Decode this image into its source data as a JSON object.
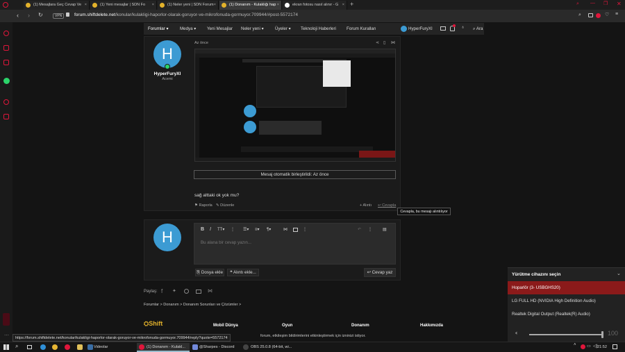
{
  "tabs": [
    {
      "label": "(1) Mesajlara Geç Cevap Ve"
    },
    {
      "label": "(1) Yeni mesajlar | SDN Fo"
    },
    {
      "label": "(1) Neler yeni | SDN Forum"
    },
    {
      "label": "(1) Donanım - Kulaklığı hap"
    },
    {
      "label": "ekran fotosu nasıl alınır - G"
    }
  ],
  "address": {
    "badge": "VPN",
    "domain": "forum.shiftdelete.net",
    "path": "/konular/kulakligi-haporlor-olarak-goruyor-ve-mikrofonuda-gormuyor.709944/#post-5572174"
  },
  "nav": {
    "items": [
      "Forumlar",
      "Medya",
      "Yeni Mesajlar",
      "Neler yeni",
      "Üyeler",
      "Teknoloji Haberleri",
      "Forum Kuralları"
    ],
    "user": "HyperFuryXI",
    "search": "Ara"
  },
  "post": {
    "avatar_letter": "H",
    "username": "HyperFuryXI",
    "role": "Acemi",
    "time": "Az önce",
    "merged_label": "Mesaj otomatik birleştirildi: Az önce",
    "message": "sağ alttaki ok yok mu?",
    "report": "Raporla",
    "edit": "Düzenle",
    "quote": "Alıntı",
    "reply": "Cevapla"
  },
  "tooltip": "Cevapla, bu mesajı alıntılıyor",
  "editor": {
    "avatar_letter": "H",
    "placeholder": "Bu alana bir cevap yazın...",
    "attach": "Dosya ekle",
    "quotes": "Alıntı ekle...",
    "submit": "Cevap yaz"
  },
  "share": {
    "label": "Paylaş:"
  },
  "breadcrumb": [
    "Forumlar",
    "Donanım",
    "Donanım Sorunları ve Çözümler"
  ],
  "footer": {
    "logo": "Shift",
    "cols": [
      "Mobil Dünya",
      "Oyun",
      "Donanım",
      "Hakkımızda"
    ],
    "notice": "forum, etkileşim bildirimlerini etkinleştirmek için izninizi istiyor."
  },
  "statusbar_url": "https://forum.shiftdelete.net/konular/kulakligi-haporlor-olarak-goruyor-ve-mikrofonuda-gormuyor.709944/reply?quote=5572174",
  "device_popup": {
    "title": "Yürütme cihazını seçin",
    "items": [
      {
        "label": "Hoparlör (3- USBGHS20)",
        "selected": true
      },
      {
        "label": "LG FULL HD (NVIDIA High Definition Audio)",
        "selected": false
      },
      {
        "label": "Realtek Digital Output (Realtek(R) Audio)",
        "selected": false
      }
    ],
    "volume": 100,
    "volume_label": "100"
  },
  "taskbar": {
    "apps": [
      "Videolar",
      "(1) Donanım - Kulakl...",
      "@Sharpes - Discord",
      "OBS 25.0.8 (64-bit, wi..."
    ],
    "time": "21:52"
  },
  "colors": {
    "accent": "#e0163b",
    "selected": "#8b1a1a",
    "avatar": "#3c9bd3"
  }
}
